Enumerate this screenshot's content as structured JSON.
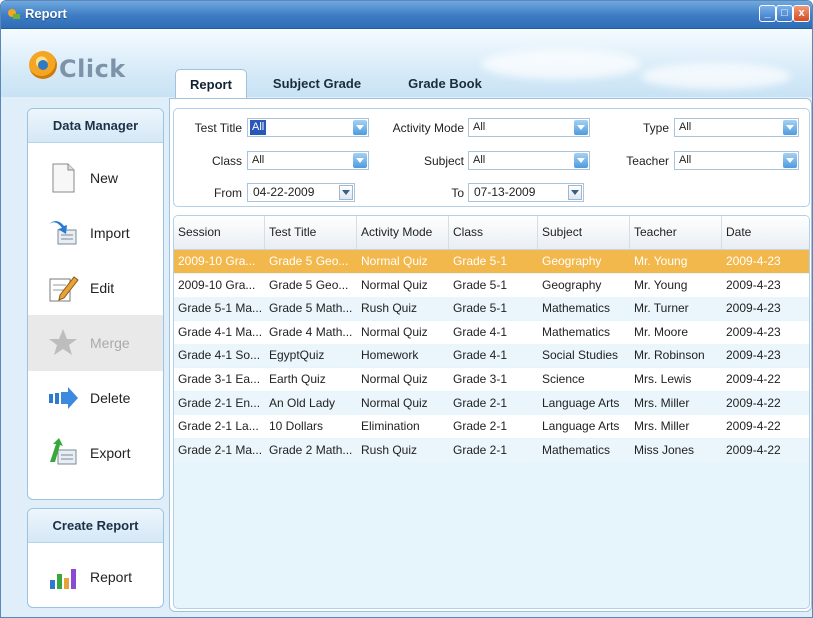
{
  "window": {
    "title": "Report",
    "minimize_glyph": "_",
    "maximize_glyph": "□",
    "close_glyph": "x"
  },
  "logo": {
    "text": "Click"
  },
  "tabs": [
    {
      "label": "Report"
    },
    {
      "label": "Subject Grade"
    },
    {
      "label": "Grade Book"
    }
  ],
  "data_manager": {
    "title": "Data Manager",
    "items": [
      {
        "label": "New",
        "icon": "document-icon"
      },
      {
        "label": "Import",
        "icon": "import-icon"
      },
      {
        "label": "Edit",
        "icon": "edit-icon"
      },
      {
        "label": "Merge",
        "icon": "merge-icon",
        "disabled": true
      },
      {
        "label": "Delete",
        "icon": "delete-icon"
      },
      {
        "label": "Export",
        "icon": "export-icon"
      }
    ]
  },
  "create_report": {
    "title": "Create Report",
    "items": [
      {
        "label": "Report",
        "icon": "bar-chart-icon"
      }
    ]
  },
  "filters": {
    "test_title": {
      "label": "Test Title",
      "value": "All"
    },
    "activity_mode": {
      "label": "Activity Mode",
      "value": "All"
    },
    "type": {
      "label": "Type",
      "value": "All"
    },
    "class": {
      "label": "Class",
      "value": "All"
    },
    "subject": {
      "label": "Subject",
      "value": "All"
    },
    "teacher": {
      "label": "Teacher",
      "value": "All"
    },
    "from": {
      "label": "From",
      "value": "04-22-2009"
    },
    "to": {
      "label": "To",
      "value": "07-13-2009"
    }
  },
  "table": {
    "columns": [
      "Session",
      "Test Title",
      "Activity Mode",
      "Class",
      "Subject",
      "Teacher",
      "Date"
    ],
    "rows": [
      [
        "2009-10 Gra...",
        "Grade 5 Geo...",
        "Normal Quiz",
        "Grade 5-1",
        "Geography",
        "Mr. Young",
        "2009-4-23"
      ],
      [
        "2009-10 Gra...",
        "Grade 5 Geo...",
        "Normal Quiz",
        "Grade 5-1",
        "Geography",
        "Mr. Young",
        "2009-4-23"
      ],
      [
        "Grade 5-1 Ma...",
        "Grade 5 Math...",
        "Rush Quiz",
        "Grade 5-1",
        "Mathematics",
        "Mr. Turner",
        "2009-4-23"
      ],
      [
        "Grade 4-1 Ma...",
        "Grade 4 Math...",
        "Normal Quiz",
        "Grade 4-1",
        "Mathematics",
        "Mr. Moore",
        "2009-4-23"
      ],
      [
        "Grade 4-1 So...",
        "EgyptQuiz",
        "Homework",
        "Grade 4-1",
        "Social Studies",
        "Mr. Robinson",
        "2009-4-23"
      ],
      [
        "Grade 3-1 Ea...",
        "Earth Quiz",
        "Normal Quiz",
        "Grade 3-1",
        "Science",
        "Mrs. Lewis",
        "2009-4-22"
      ],
      [
        "Grade 2-1 En...",
        "An Old Lady",
        "Normal Quiz",
        "Grade 2-1",
        "Language Arts",
        "Mrs. Miller",
        "2009-4-22"
      ],
      [
        "Grade 2-1 La...",
        "10 Dollars",
        "Elimination",
        "Grade 2-1",
        "Language Arts",
        "Mrs. Miller",
        "2009-4-22"
      ],
      [
        "Grade 2-1 Ma...",
        "Grade 2 Math...",
        "Rush Quiz",
        "Grade 2-1",
        "Mathematics",
        "Miss Jones",
        "2009-4-22"
      ]
    ],
    "selected_row": 0
  },
  "colors": {
    "selected_row": "#f3b84b",
    "accent": "#3d7cc4"
  }
}
